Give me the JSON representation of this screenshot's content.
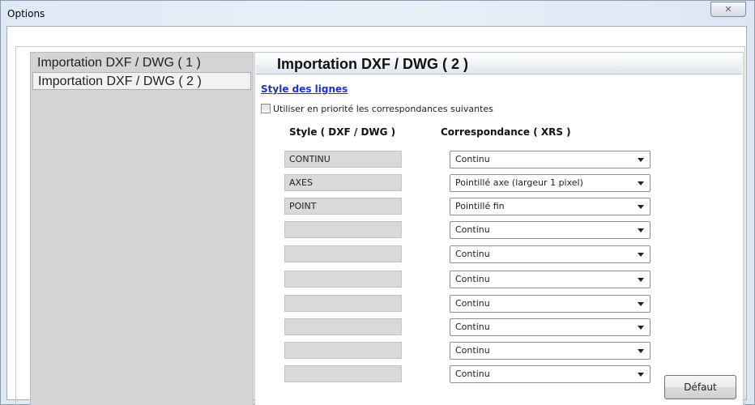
{
  "window": {
    "title": "Options",
    "close_icon": "✕"
  },
  "sidebar": {
    "items": [
      {
        "label": "Importation DXF / DWG ( 1 )",
        "selected": false
      },
      {
        "label": "Importation DXF / DWG ( 2 )",
        "selected": true
      }
    ]
  },
  "panel": {
    "title": "Importation DXF / DWG ( 2 )",
    "section_link": "Style des lignes",
    "checkbox": {
      "label": "Utiliser en priorité les correspondances suivantes",
      "checked": false
    },
    "col_style_header": "Style ( DXF / DWG )",
    "col_corr_header": "Correspondance ( XRS )",
    "rows": [
      {
        "style": "CONTINU",
        "correspondance": "Continu"
      },
      {
        "style": "AXES",
        "correspondance": "Pointillé axe (largeur 1 pixel)"
      },
      {
        "style": "POINT",
        "correspondance": "Pointillé fin"
      },
      {
        "style": "",
        "correspondance": "Continu"
      },
      {
        "style": "",
        "correspondance": "Continu"
      },
      {
        "style": "",
        "correspondance": "Continu"
      },
      {
        "style": "",
        "correspondance": "Continu"
      },
      {
        "style": "",
        "correspondance": "Continu"
      },
      {
        "style": "",
        "correspondance": "Continu"
      },
      {
        "style": "",
        "correspondance": "Continu"
      }
    ],
    "default_button": "Défaut"
  },
  "colors": {
    "link": "#1a33cc",
    "list_bg": "#d4d4d4",
    "field_bg": "#d9d9d9"
  }
}
